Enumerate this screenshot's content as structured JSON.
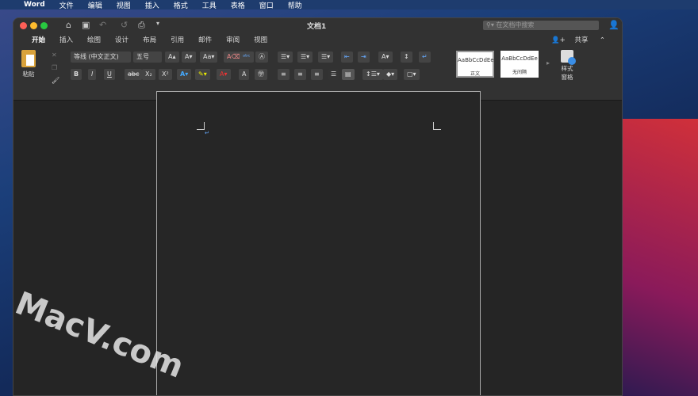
{
  "menubar": {
    "app": "Word",
    "items": [
      "文件",
      "编辑",
      "视图",
      "插入",
      "格式",
      "工具",
      "表格",
      "窗口",
      "帮助"
    ]
  },
  "window": {
    "title": "文档1",
    "search_placeholder": "在文档中搜索",
    "share": "共享"
  },
  "tabs": [
    "开始",
    "插入",
    "绘图",
    "设计",
    "布局",
    "引用",
    "邮件",
    "审阅",
    "视图"
  ],
  "ribbon": {
    "paste": "粘贴",
    "font": "等线 (中文正文)",
    "size": "五号",
    "bold": "B",
    "italic": "I",
    "underline": "U",
    "strike": "abc",
    "sub": "X₂",
    "sup": "X²",
    "styles": [
      {
        "preview": "AaBbCcDdEe",
        "name": "正文"
      },
      {
        "preview": "AaBbCcDdEe",
        "name": "无间隔"
      }
    ],
    "styles_pane": "样式\n窗格"
  },
  "watermark": "MacV.com"
}
